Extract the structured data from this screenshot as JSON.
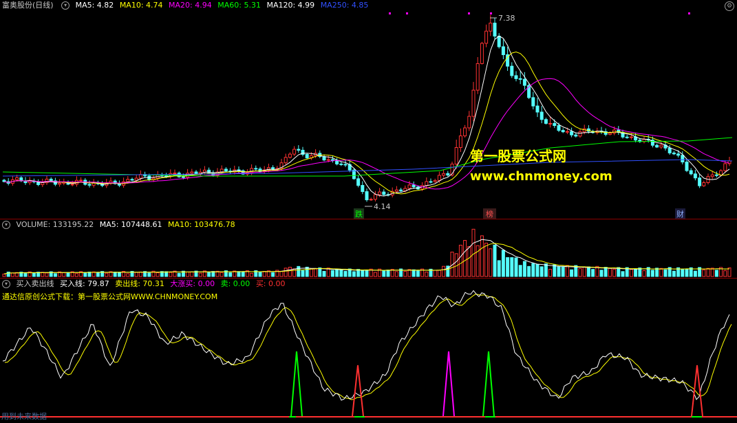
{
  "main_panel": {
    "stock_name": "富奥股份(日线)",
    "indicators": [
      {
        "label": "MA5: 4.82",
        "color": "#ffffff"
      },
      {
        "label": "MA10: 4.74",
        "color": "#ffff00"
      },
      {
        "label": "MA20: 4.94",
        "color": "#ff00ff"
      },
      {
        "label": "MA60: 5.31",
        "color": "#00ff00"
      },
      {
        "label": "MA120: 4.99",
        "color": "#ffffff"
      },
      {
        "label": "MA250: 4.85",
        "color": "#3050ff"
      }
    ],
    "high_label": "7.38",
    "low_label": "4.14",
    "event_tags": {
      "drop": "跌",
      "list": "榜",
      "finance": "财"
    },
    "watermark": {
      "cn": "第一股票公式网",
      "url": "www.chnmoney.com"
    }
  },
  "volume_panel": {
    "indicators": [
      {
        "label": "VOLUME: 133195.22",
        "color": "#c8c8c8"
      },
      {
        "label": "MA5: 107448.61",
        "color": "#ffffff"
      },
      {
        "label": "MA10: 103476.78",
        "color": "#ffff00"
      }
    ]
  },
  "signal_panel": {
    "indicators": [
      {
        "label": "买入卖出线",
        "color": "#c8c8c8"
      },
      {
        "label": "买入线: 79.87",
        "color": "#ffffff"
      },
      {
        "label": "卖出线: 70.31",
        "color": "#ffff00"
      },
      {
        "label": "大涨买: 0.00",
        "color": "#ff00ff"
      },
      {
        "label": "卖: 0.00",
        "color": "#00ff00"
      },
      {
        "label": "买: 0.00",
        "color": "#ff3030"
      }
    ],
    "info_text": "通达信原创公式下载：第一股票公式网WWW.CHNMONEY.COM"
  },
  "footer_text": "用到未来数据",
  "colors": {
    "up": "#ff3232",
    "down": "#54fcfc",
    "ma5": "#ffffff",
    "ma10": "#ffff00",
    "ma20": "#ff00ff",
    "ma60": "#00ff00",
    "ma250": "#3050ff"
  }
}
